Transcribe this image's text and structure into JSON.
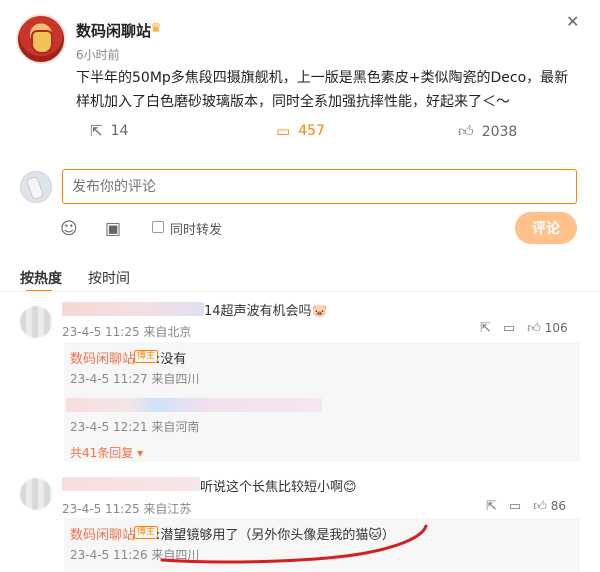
{
  "post": {
    "author": "数码闲聊站",
    "time": "6小时前",
    "body": "下半年的50Mp多焦段四摄旗舰机，上一版是黑色素皮+类似陶瓷的Deco，最新样机加入了白色磨砂玻璃版本，同时全系加强抗摔性能，好起来了＜～",
    "repost_count": "14",
    "comment_count": "457",
    "like_count": "2038"
  },
  "composer": {
    "placeholder": "发布你的评论",
    "repost_label": "同时转发",
    "submit_label": "评论"
  },
  "tabs": {
    "hot": "按热度",
    "time": "按时间"
  },
  "comments": [
    {
      "text": "14超声波有机会吗🐷",
      "meta": "23-4-5 11:25 来自北京",
      "likes": "106",
      "reply": {
        "name": "数码闲聊站",
        "badge": "博主",
        "text": ":没有",
        "meta": "23-4-5 11:27 来自四川"
      },
      "reply2_meta": "23-4-5 12:21 来自河南",
      "more": "共41条回复"
    },
    {
      "text": "听说这个长焦比较短小啊😊",
      "meta": "23-4-5 11:25 来自江苏",
      "likes": "86",
      "reply": {
        "name": "数码闲聊站",
        "badge": "博主",
        "text": ":潜望镜够用了（另外你头像是我的猫🐱）",
        "meta": "23-4-5 11:26 来自四川"
      }
    }
  ],
  "colors": {
    "accent": "#ff8200",
    "name": "#eb7350",
    "annotation": "#d31f1f"
  },
  "icons": {
    "close": "close-icon",
    "repost": "repost-icon",
    "comment": "comment-icon",
    "like": "thumbs-up-icon",
    "emoji": "emoji-icon",
    "image": "image-icon"
  }
}
